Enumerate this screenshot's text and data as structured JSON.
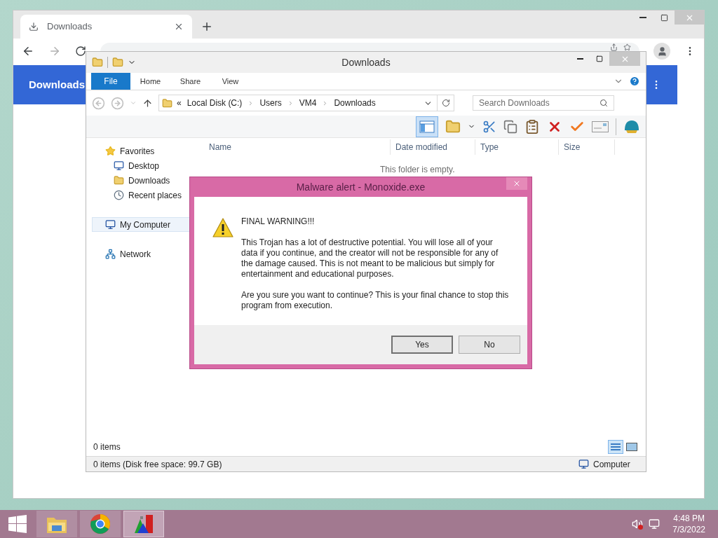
{
  "chrome": {
    "tab": {
      "title": "Downloads"
    },
    "header": {
      "title": "Downloads"
    }
  },
  "explorer": {
    "title": "Downloads",
    "ribbon_tabs": [
      {
        "label": "File",
        "kind": "file"
      },
      {
        "label": "Home",
        "kind": "tab"
      },
      {
        "label": "Share",
        "kind": "tab"
      },
      {
        "label": "View",
        "kind": "tab"
      }
    ],
    "overflow": "«",
    "path": [
      "Local Disk (C:)",
      "Users",
      "VM4",
      "Downloads"
    ],
    "search": {
      "placeholder": "Search Downloads"
    },
    "nav": [
      {
        "label": "Favorites",
        "kind": "star",
        "selected": false,
        "children": [
          {
            "label": "Desktop",
            "kind": "desktop",
            "selected": false
          },
          {
            "label": "Downloads",
            "kind": "folder",
            "selected": false
          },
          {
            "label": "Recent places",
            "kind": "recent",
            "selected": false
          }
        ]
      },
      {
        "label": "My Computer",
        "kind": "computer",
        "selected": true
      },
      {
        "label": "Network",
        "kind": "network",
        "selected": false
      }
    ],
    "columns": [
      "Name",
      "Date modified",
      "Type",
      "Size"
    ],
    "empty_message": "This folder is empty.",
    "item_count": "0 items",
    "status": "0 items (Disk free space: 99.7 GB)",
    "location": "Computer"
  },
  "dialog": {
    "title": "Malware alert - Monoxide.exe",
    "heading": "FINAL WARNING!!!",
    "paragraphs": [
      "This Trojan has a lot of destructive potential. You will lose all of your data if you continue, and the creator will not be responsible for any of the damage caused. This is not meant to be malicious but simply for entertainment and educational purposes.",
      "Are you sure you want to continue? This is your final chance to stop this program from execution."
    ],
    "buttons": [
      {
        "label": "Yes",
        "default": true
      },
      {
        "label": "No",
        "default": false
      }
    ]
  },
  "taskbar": {
    "apps": [
      {
        "kind": "explorer",
        "active": false
      },
      {
        "kind": "chrome",
        "active": false
      },
      {
        "kind": "app",
        "active": true
      }
    ],
    "time": "4:48 PM",
    "date": "7/3/2022"
  }
}
